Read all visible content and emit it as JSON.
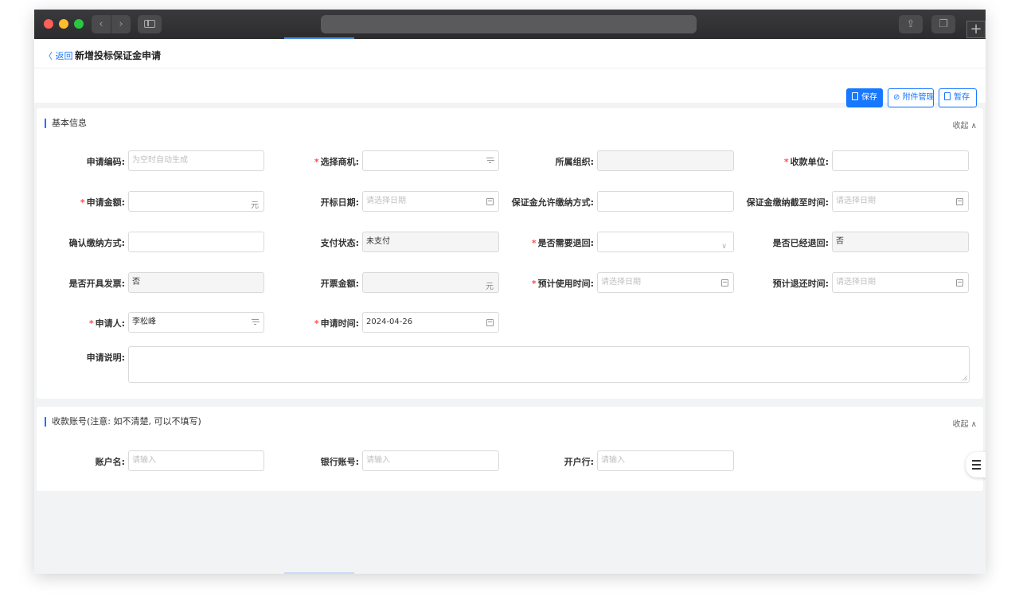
{
  "header": {
    "back_label": "〈 返回",
    "title": "新增投标保证金申请",
    "buttons": {
      "save": "保存",
      "attach": "附件管理",
      "draft": "暂存"
    }
  },
  "basic_section": {
    "title": "基本信息",
    "collapse_label": "收起 ∧",
    "fields": {
      "apply_no": {
        "label": "申请编码:",
        "placeholder": "为空时自动生成"
      },
      "opportunity": {
        "label": "选择商机:",
        "value": ""
      },
      "org": {
        "label": "所属组织:",
        "value": ""
      },
      "payee": {
        "label": "收款单位:",
        "value": ""
      },
      "amount": {
        "label": "申请金额:",
        "suffix": "元"
      },
      "bid_date": {
        "label": "开标日期:",
        "placeholder": "请选择日期"
      },
      "pay_method": {
        "label": "保证金允许缴纳方式:",
        "value": ""
      },
      "deadline": {
        "label": "保证金缴纳截至时间:",
        "placeholder": "请选择日期"
      },
      "confirm_method": {
        "label": "确认缴纳方式:",
        "value": ""
      },
      "pay_status": {
        "label": "支付状态:",
        "value": "未支付"
      },
      "need_return": {
        "label": "是否需要退回:",
        "value": ""
      },
      "returned": {
        "label": "是否已经退回:",
        "value": "否"
      },
      "invoiced": {
        "label": "是否开具发票:",
        "value": "否"
      },
      "invoice_amount": {
        "label": "开票金额:",
        "suffix": "元"
      },
      "use_time": {
        "label": "预计使用时间:",
        "placeholder": "请选择日期"
      },
      "return_time": {
        "label": "预计退还时间:",
        "placeholder": "请选择日期"
      },
      "applicant": {
        "label": "申请人:",
        "value": "李松峰"
      },
      "apply_time": {
        "label": "申请时间:",
        "value": "2024-04-26"
      },
      "description": {
        "label": "申请说明:",
        "value": ""
      }
    }
  },
  "account_section": {
    "title": "收款账号(注意: 如不清楚, 可以不填写)",
    "collapse_label": "收起 ∧",
    "fields": {
      "account_name": {
        "label": "账户名:",
        "placeholder": "请输入"
      },
      "account_no": {
        "label": "银行账号:",
        "placeholder": "请输入"
      },
      "bank": {
        "label": "开户行:",
        "placeholder": "请输入"
      }
    }
  },
  "colors": {
    "primary": "#1677ff",
    "required": "#ff4d4f"
  }
}
